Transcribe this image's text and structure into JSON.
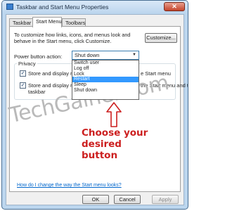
{
  "window": {
    "title": "Taskbar and Start Menu Properties",
    "close_glyph": "✕"
  },
  "tabs": [
    {
      "label": "Taskbar"
    },
    {
      "label": "Start Menu"
    },
    {
      "label": "Toolbars"
    }
  ],
  "start_menu": {
    "description": "To customize how links, icons, and menus look and behave in the Start menu, click Customize.",
    "customize_label": "Customize...",
    "power_label": "Power button action:",
    "power_value": "Shut down",
    "dropdown_options": [
      "Switch user",
      "Log off",
      "Lock",
      "Restart",
      "Sleep",
      "Shut down"
    ],
    "dropdown_selected": "Restart",
    "privacy_label": "Privacy",
    "privacy_items": [
      {
        "text_left": "Store and display r",
        "text_right": "e Start menu"
      },
      {
        "text_left": "Store and display r",
        "text_right": "the Start menu and the",
        "text_line2": "taskbar"
      }
    ],
    "help_link": "How do I change the way the Start menu looks?"
  },
  "buttons": {
    "ok": "OK",
    "cancel": "Cancel",
    "apply": "Apply"
  },
  "overlay": {
    "watermark": "TechGainer.com",
    "annotation_lines": [
      "Choose your",
      "desired button"
    ],
    "annotation_color": "#cc1f1f"
  }
}
